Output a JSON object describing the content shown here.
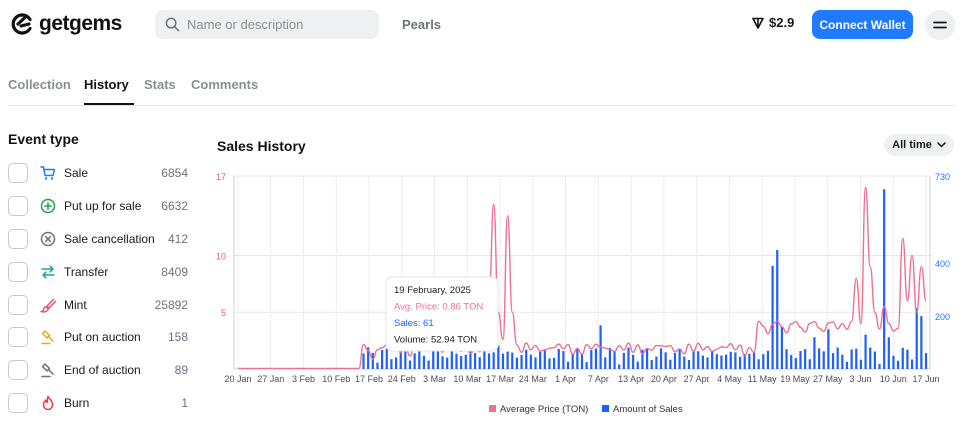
{
  "header": {
    "logo_text": "getgems",
    "search_placeholder": "Name or description",
    "nav_link": "Pearls",
    "ton_price": "$2.9",
    "connect_label": "Connect Wallet"
  },
  "tabs": [
    {
      "label": "Collection",
      "active": false
    },
    {
      "label": "History",
      "active": true
    },
    {
      "label": "Stats",
      "active": false
    },
    {
      "label": "Comments",
      "active": false
    }
  ],
  "sidebar": {
    "title": "Event type",
    "items": [
      {
        "label": "Sale",
        "count": "6854",
        "icon": "cart-icon",
        "color": "#1f7aff"
      },
      {
        "label": "Put up for sale",
        "count": "6632",
        "icon": "plus-circle-icon",
        "color": "#22a04b"
      },
      {
        "label": "Sale cancellation",
        "count": "412",
        "icon": "x-circle-icon",
        "color": "#6d7278"
      },
      {
        "label": "Transfer",
        "count": "8409",
        "icon": "transfer-icon",
        "color": "#1fa39a"
      },
      {
        "label": "Mint",
        "count": "25892",
        "icon": "brush-icon",
        "color": "#ef4f6d"
      },
      {
        "label": "Put on auction",
        "count": "158",
        "icon": "gavel-icon",
        "color": "#f0a51c"
      },
      {
        "label": "End of auction",
        "count": "89",
        "icon": "gavel-end-icon",
        "color": "#6d7278"
      },
      {
        "label": "Burn",
        "count": "1",
        "icon": "fire-icon",
        "color": "#ef3b3b"
      }
    ]
  },
  "chart": {
    "title": "Sales History",
    "range_label": "All time"
  },
  "chart_data": {
    "type": "bar+line",
    "x_labels": [
      "20 Jan",
      "27 Jan",
      "3 Feb",
      "10 Feb",
      "17 Feb",
      "24 Feb",
      "3 Mar",
      "10 Mar",
      "17 Mar",
      "24 Mar",
      "1 Apr",
      "7 Apr",
      "13 Apr",
      "20 Apr",
      "27 Apr",
      "4 May",
      "11 May",
      "19 May",
      "27 May",
      "3 Jun",
      "10 Jun",
      "17 Jun"
    ],
    "y_left": {
      "ticks": [
        "17",
        "10",
        "5"
      ],
      "tick_values": [
        17,
        10,
        5
      ],
      "max": 17,
      "color": "#e8577a"
    },
    "y_right": {
      "ticks": [
        "730",
        "400",
        "200"
      ],
      "tick_values": [
        730,
        400,
        200
      ],
      "max": 730,
      "color": "#1f7aff"
    },
    "grid": true,
    "legend_position": "bottom",
    "series": [
      {
        "name": "Average Price (TON)",
        "type": "line",
        "color": "#f0708f",
        "values": [
          0.05,
          0.05,
          0.05,
          0.05,
          0.05,
          0.05,
          0.05,
          0.05,
          0.05,
          0.05,
          0.05,
          0.05,
          0.05,
          0.05,
          0.05,
          0.05,
          0.05,
          0.05,
          0.05,
          0.05,
          0.05,
          0.05,
          0.05,
          0.05,
          0.05,
          0.05,
          0.05,
          0.05,
          0.05,
          0.05,
          0.05,
          0.05,
          0.05,
          0.05,
          0.05,
          0.05,
          0.05,
          0.05,
          0.05,
          0.05,
          0.05,
          0.05,
          0.05,
          0.05,
          0.05,
          0.05,
          0.05,
          0.05,
          0.05,
          0.05,
          0.05,
          0.05,
          0.05,
          0.05,
          0.05,
          0.05,
          0.05,
          0.05,
          0.05,
          0.05,
          0.05,
          0.05,
          0.05,
          0.05,
          0.05,
          0.05,
          0.05,
          0.05,
          0.05,
          0.05,
          0.05,
          0.05,
          0.05,
          0.05,
          0.05,
          0.05,
          0.05,
          0.05,
          0.05,
          0.05,
          0.05,
          0.05,
          0.05,
          0.05,
          0.05,
          0.05,
          0.05,
          0.05,
          0.05,
          0.05,
          0.05,
          0.05,
          0.05,
          0.05,
          0.05,
          0.05,
          0.05,
          0.05,
          0.05,
          0.05,
          0.05,
          0.05,
          0.05,
          0.05,
          0.05,
          0.05,
          0.05,
          0.05,
          0.05,
          0.05,
          0.05,
          0.05,
          0.05,
          0.05,
          0.05,
          0.05,
          0.05,
          0.05,
          0.05,
          0.05,
          0.05,
          0.05,
          0.05,
          0.05,
          0.05,
          0.05,
          0.05,
          0.05,
          0.05,
          0.05,
          0.05,
          0.05,
          0.05,
          0.05,
          0.05,
          0.05,
          0.05,
          0.05,
          0.05,
          0.05,
          0.05,
          0.05,
          0.05,
          0.05,
          0.05,
          0.05,
          0.05,
          0.05,
          0.05,
          0.05,
          0.05,
          0.05,
          0.05,
          0.05,
          0.05,
          0.05,
          0.05,
          0.05,
          0.05,
          0.05,
          0.05,
          0.05,
          0.05,
          0.05,
          0.05,
          0.05,
          0.05,
          0.05,
          0.05,
          0.05,
          0.05,
          0.05,
          0.05,
          0.05,
          0.05,
          0.05,
          0.05,
          0.05,
          0.05,
          0.05,
          0.05,
          0.05,
          0.05,
          0.05,
          0.05,
          0.05,
          0.05,
          0.05,
          0.05,
          0.05,
          0.05,
          0.05,
          0.05,
          0.05,
          0.05,
          0.05,
          0.05,
          0.05,
          0.05,
          0.05,
          0.05,
          0.05,
          0.05,
          0.05,
          0.05,
          0.05,
          0.05,
          0.05,
          0.05,
          0.05,
          0.05,
          0.05,
          0.05,
          0.05,
          0.05,
          0.05,
          0.05,
          0.05,
          0.05,
          0.05,
          0.05,
          0.05,
          0.05,
          0.05,
          0.05,
          0.05,
          0.05,
          0.05,
          0.05,
          0.05,
          0.05,
          0.05,
          0.05,
          0.05,
          0.05,
          0.05,
          0.05,
          0.05,
          0.05,
          0.05,
          0.05,
          0.05
        ]
      },
      {
        "name": "Amount of Sales",
        "type": "bar",
        "color": "#1f5fff",
        "values": []
      }
    ],
    "x_start": "2025-01-20",
    "x_end": "2025-06-17"
  },
  "tooltip": {
    "date": "19 February, 2025",
    "avg_price": "Avg. Price: 0.86 TON",
    "sales": "Sales: 61",
    "volume": "Volume: 52.94 TON"
  }
}
